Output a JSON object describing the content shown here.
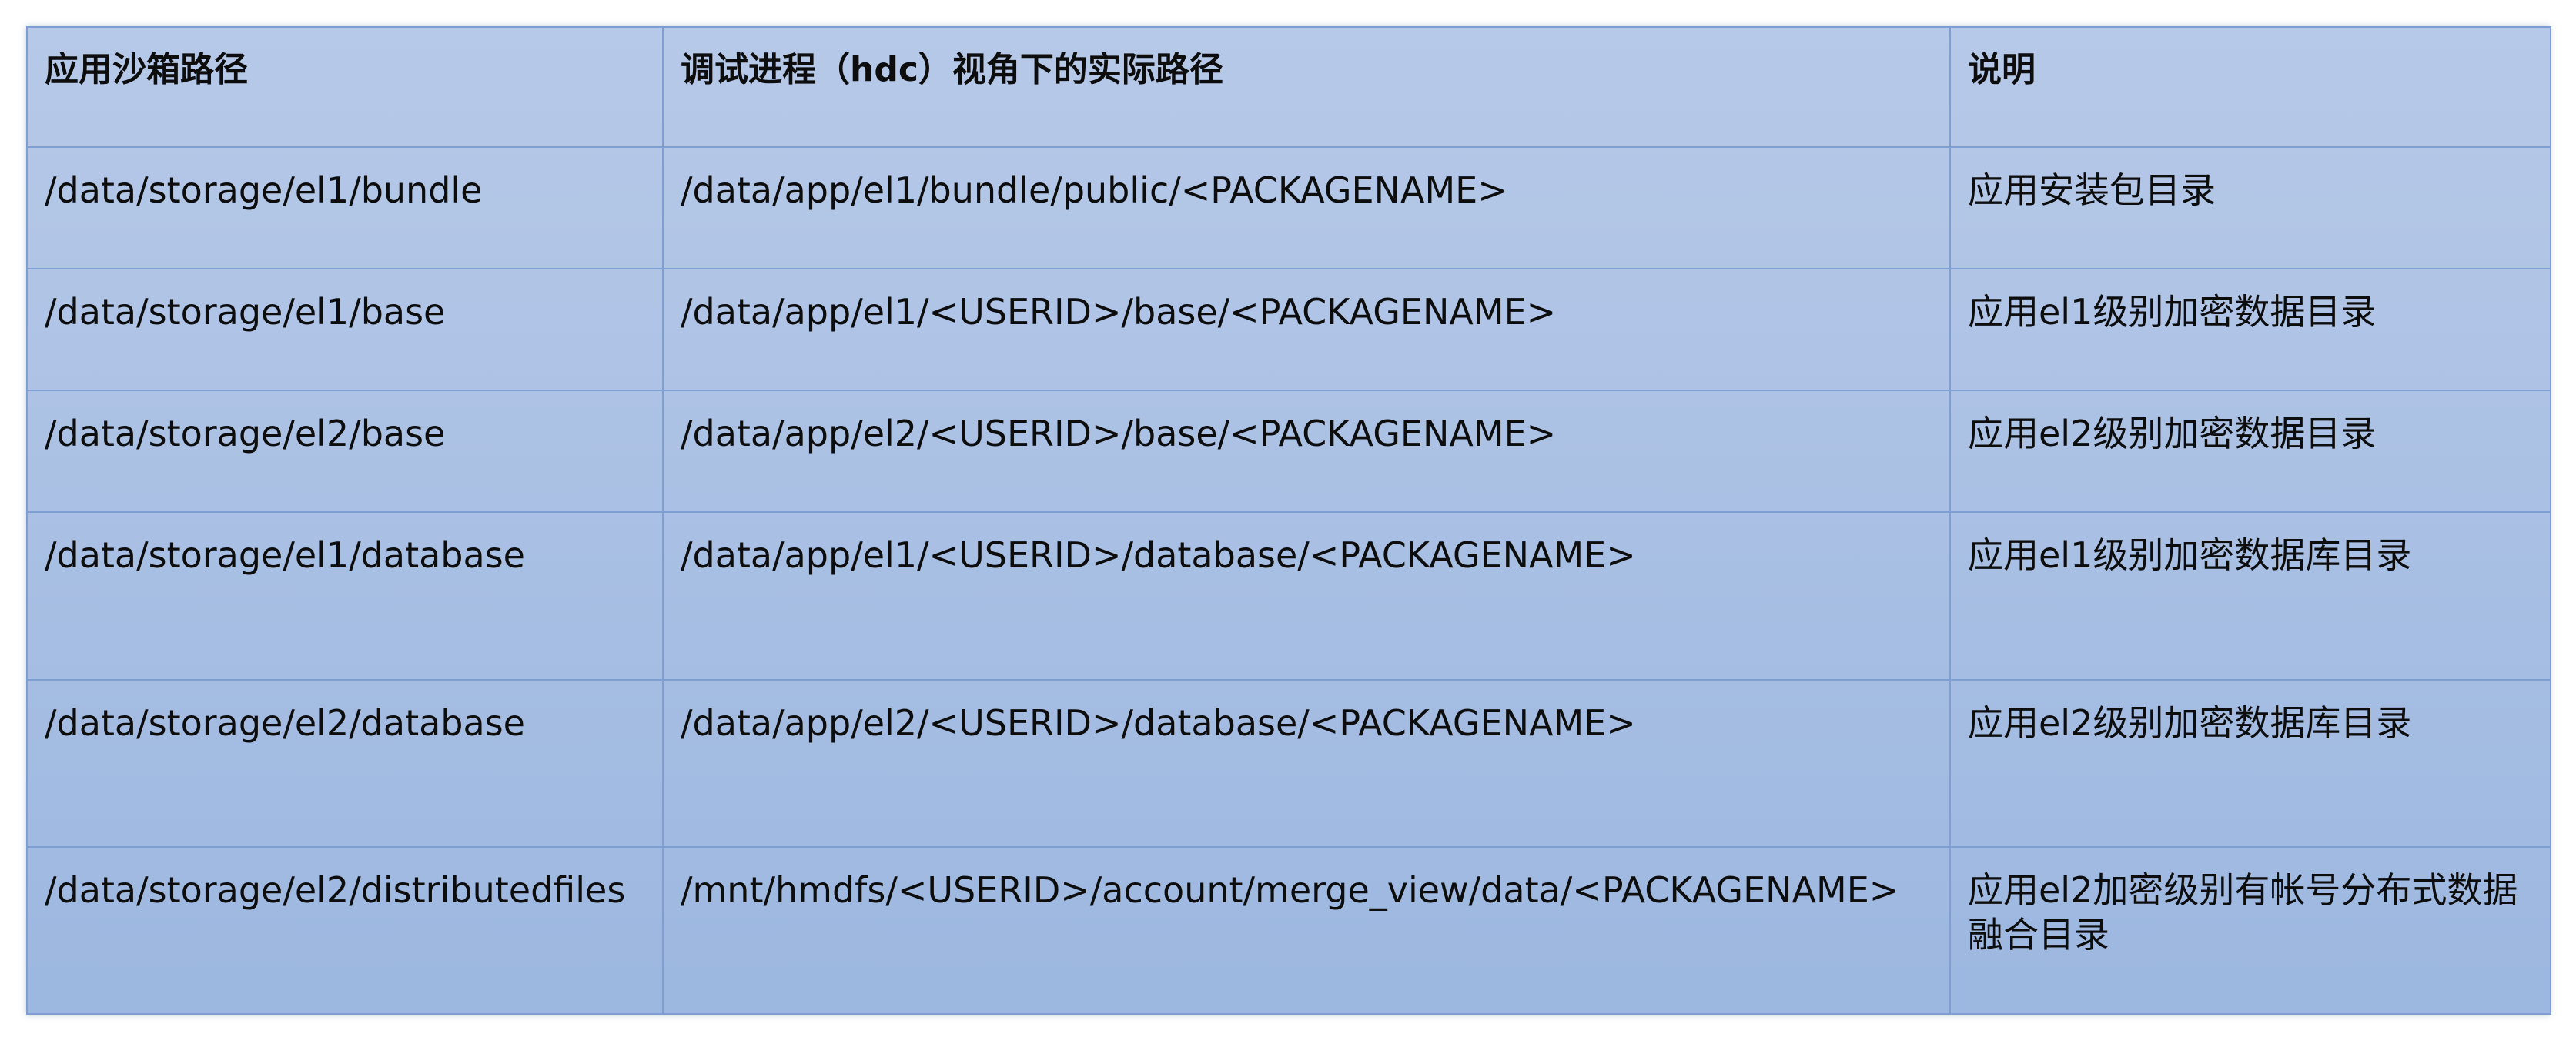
{
  "table": {
    "headers": [
      "应用沙箱路径",
      "调试进程（hdc）视角下的实际路径",
      "说明"
    ],
    "rows": [
      [
        "/data/storage/el1/bundle",
        "/data/app/el1/bundle/public/<PACKAGENAME>",
        "应用安装包目录"
      ],
      [
        "/data/storage/el1/base",
        "/data/app/el1/<USERID>/base/<PACKAGENAME>",
        "应用el1级别加密数据目录"
      ],
      [
        "/data/storage/el2/base",
        "/data/app/el2/<USERID>/base/<PACKAGENAME>",
        "应用el2级别加密数据目录"
      ],
      [
        "/data/storage/el1/database",
        "/data/app/el1/<USERID>/database/<PACKAGENAME>",
        "应用el1级别加密数据库目录"
      ],
      [
        "/data/storage/el2/database",
        "/data/app/el2/<USERID>/database/<PACKAGENAME>",
        "应用el2级别加密数据库目录"
      ],
      [
        "/data/storage/el2/distributedfiles",
        "/mnt/hmdfs/<USERID>/account/merge_view/data/<PACKAGENAME>",
        "应用el2加密级别有帐号分布式数据融合目录"
      ]
    ]
  }
}
